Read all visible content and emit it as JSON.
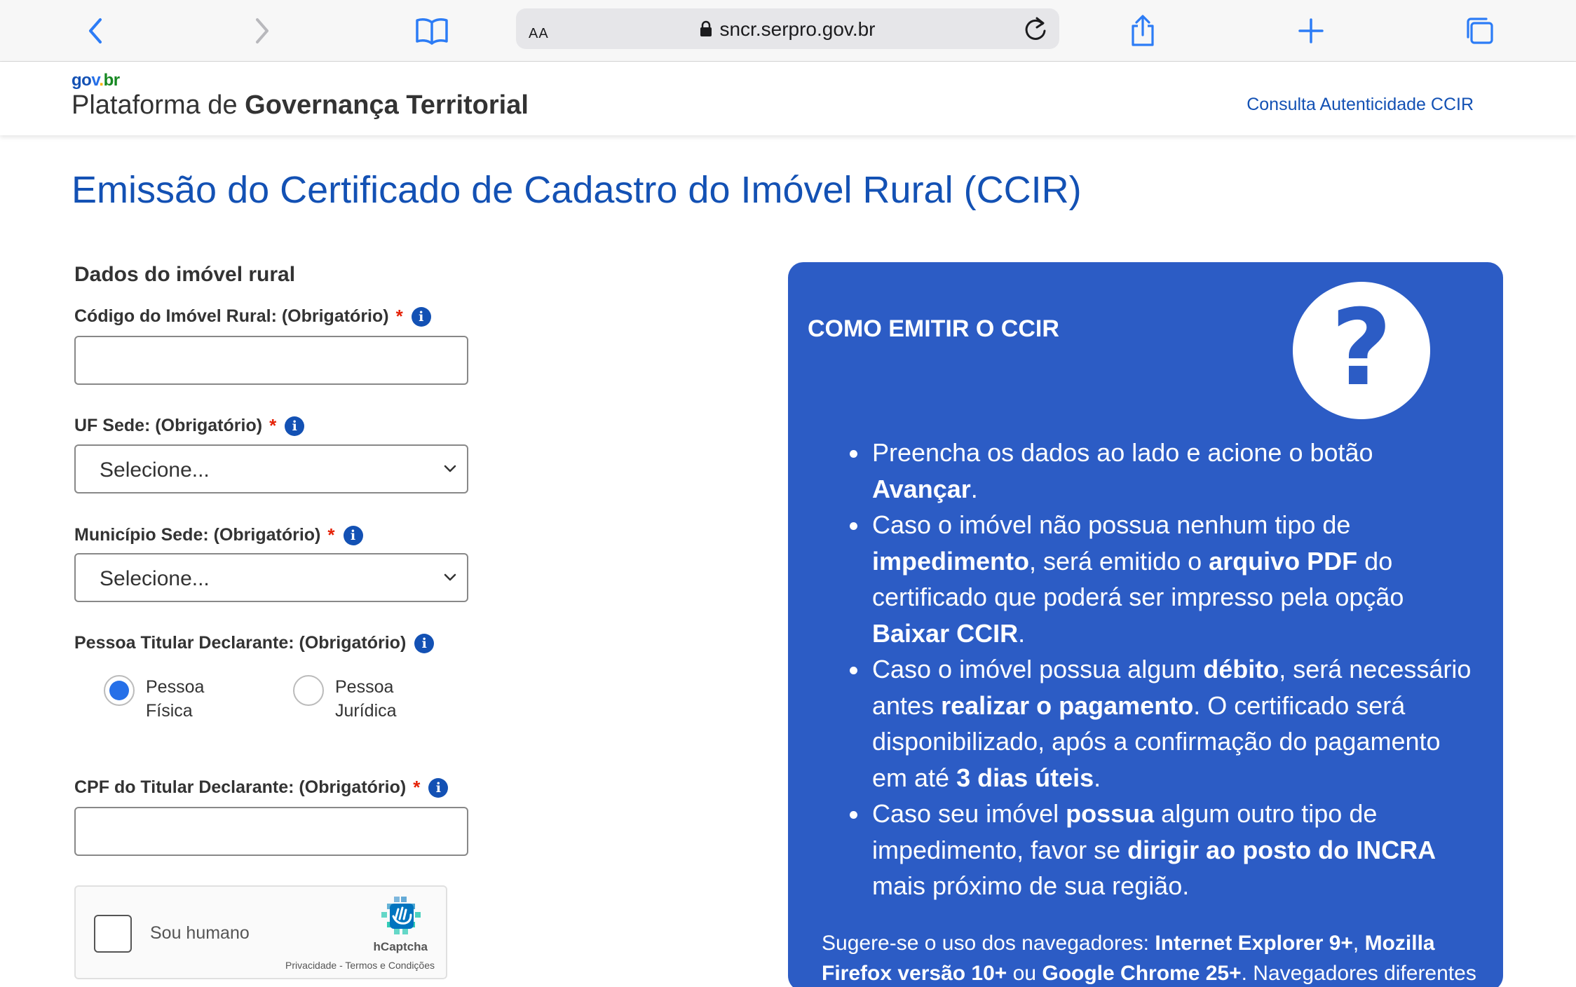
{
  "browser": {
    "text_size_label": "AA",
    "url": "sncr.serpro.gov.br",
    "icons": [
      "back-icon",
      "forward-icon",
      "bookmarks-icon",
      "lock-icon",
      "reload-icon",
      "share-icon",
      "new-tab-icon",
      "tabs-icon"
    ]
  },
  "header": {
    "logo": {
      "g1": "go",
      "g2": "v",
      "g3": ".",
      "g4": "br"
    },
    "title_prefix": "Plataforma de ",
    "title_bold": "Governança Territorial",
    "link": "Consulta Autenticidade CCIR"
  },
  "page": {
    "title": "Emissão do Certificado de Cadastro do Imóvel Rural (CCIR)"
  },
  "form": {
    "section_title": "Dados do imóvel rural",
    "required_marker": "*",
    "info_glyph": "i",
    "codigo": {
      "label": "Código do Imóvel Rural: (Obrigatório)",
      "value": ""
    },
    "uf": {
      "label": "UF Sede: (Obrigatório)",
      "selected": "Selecione..."
    },
    "municipio": {
      "label": "Município Sede: (Obrigatório)",
      "selected": "Selecione..."
    },
    "pessoa": {
      "label": "Pessoa Titular Declarante: (Obrigatório)",
      "options": [
        {
          "line1": "Pessoa",
          "line2": "Física",
          "checked": true
        },
        {
          "line1": "Pessoa",
          "line2": "Jurídica",
          "checked": false
        }
      ]
    },
    "cpf": {
      "label": "CPF do Titular Declarante: (Obrigatório)",
      "value": ""
    },
    "captcha": {
      "text": "Sou humano",
      "brand": "hCaptcha",
      "links": "Privacidade - Termos e Condições"
    }
  },
  "panel": {
    "title": "COMO EMITIR O CCIR",
    "help_glyph": "?",
    "bullets": [
      {
        "t1": "Preencha os dados ao lado e acione o botão ",
        "b1": "Avançar",
        "t2": "."
      },
      {
        "t1": "Caso o imóvel não possua nenhum tipo de ",
        "b1": "impedimento",
        "t2": ", será emitido o ",
        "b2": "arquivo PDF",
        "t3": " do certificado que poderá ser impresso pela opção ",
        "b3": "Baixar CCIR",
        "t4": "."
      },
      {
        "t1": "Caso o imóvel possua algum ",
        "b1": "débito",
        "t2": ", será necessário antes ",
        "b2": "realizar o pagamento",
        "t3": ". O certificado será disponibilizado, após a confirmação do pagamento em até ",
        "b3": "3 dias úteis",
        "t4": "."
      },
      {
        "t1": "Caso seu imóvel ",
        "b1": "possua",
        "t2": " algum outro tipo de impedimento, favor se ",
        "b2": "dirigir ao posto do INCRA",
        "t3": " mais próximo de sua região."
      }
    ],
    "note": {
      "t1": "Sugere-se o uso dos navegadores: ",
      "b1": "Internet Explorer 9+",
      "t2": ", ",
      "b2": "Mozilla Firefox versão 10+",
      "t3": " ou ",
      "b3": "Google Chrome 25+",
      "t4": ". Navegadores diferentes"
    }
  },
  "colors": {
    "brand_blue": "#1351b4",
    "panel_blue": "#2c5cc5",
    "ios_blue": "#2c7cf6",
    "required_red": "#e52207"
  }
}
